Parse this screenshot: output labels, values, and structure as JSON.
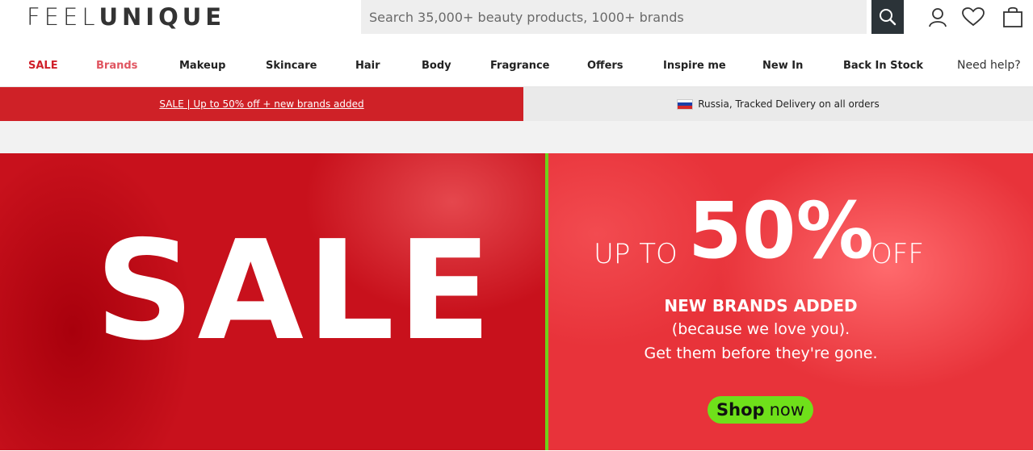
{
  "header": {
    "logo_thin": "FEEL",
    "logo_bold": "UNIQUE",
    "search_placeholder": "Search 35,000+ beauty products, 1000+ brands",
    "icons": [
      "search-icon",
      "account-icon",
      "wishlist-heart-icon",
      "basket-icon"
    ]
  },
  "nav": {
    "items": [
      "SALE",
      "Brands",
      "Makeup",
      "Skincare",
      "Hair",
      "Body",
      "Fragrance",
      "Offers",
      "Inspire me",
      "New In",
      "Back In Stock"
    ],
    "help": "Need help?",
    "accent_sale": "#d0202a",
    "accent_brands": "#e05560"
  },
  "strip": {
    "left_text": "SALE | Up to 50% off + new brands added",
    "right_text": "Russia, Tracked Delivery on all orders",
    "left_bg": "#cf2127",
    "flag": "russia-flag-icon"
  },
  "hero": {
    "sale": "SALE",
    "up_to": "UP TO",
    "percent": "50%",
    "off": "OFF",
    "new_brands": "NEW BRANDS ADDED",
    "line2": "(because we love you).",
    "line3": "Get them before they're gone.",
    "shop_bold": "Shop",
    "shop_rest": "now",
    "button_color": "#6fe01a"
  }
}
